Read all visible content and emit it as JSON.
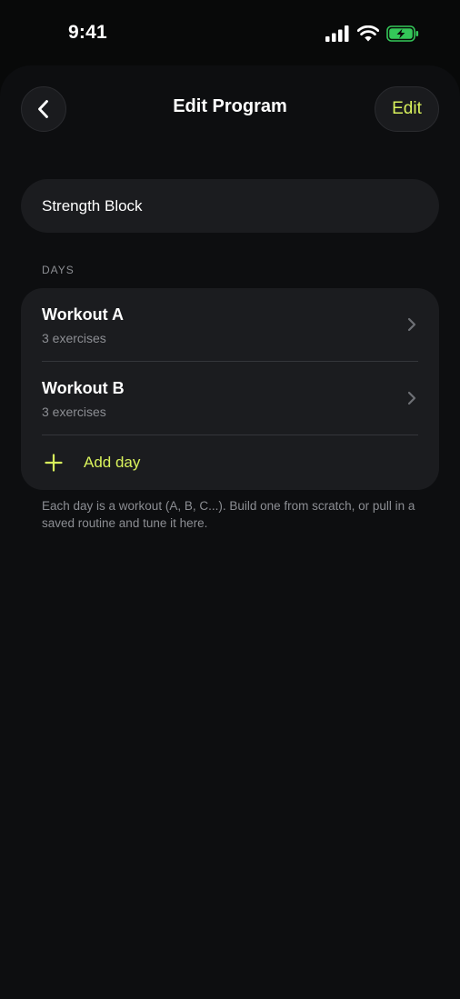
{
  "status_bar": {
    "time": "9:41",
    "icons": [
      "signal-icon",
      "wifi-icon",
      "battery-charging-icon"
    ]
  },
  "nav": {
    "back_icon": "chevron-left-icon",
    "title": "Edit Program",
    "edit_label": "Edit"
  },
  "program_name": {
    "value": "Strength Block"
  },
  "days_section": {
    "header": "DAYS",
    "items": [
      {
        "title": "Workout A",
        "subtitle": "3 exercises",
        "icon": "chevron-right-icon"
      },
      {
        "title": "Workout B",
        "subtitle": "3 exercises",
        "icon": "chevron-right-icon"
      }
    ],
    "add_icon": "plus-icon",
    "add_label": "Add day"
  },
  "helper_text": "Each day is a workout (A, B, C...). Build one from scratch, or pull in a saved routine and tune it here.",
  "colors": {
    "background": "#080909",
    "sheet": "#0d0e10",
    "card": "#1b1c1f",
    "accent": "#d9f25c",
    "secondary_text": "#8c8e93",
    "battery": "#34c759"
  }
}
